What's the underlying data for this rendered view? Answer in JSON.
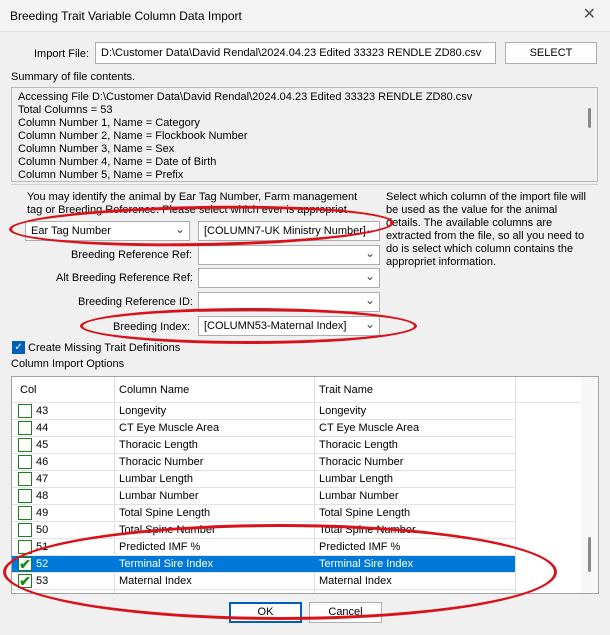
{
  "window": {
    "title": "Breeding Trait Variable Column Data Import",
    "close_glyph": "✕"
  },
  "import_file": {
    "label": "Import File:",
    "value": "D:\\Customer Data\\David Rendal\\2024.04.23 Edited 33323 RENDLE ZD80.csv",
    "select_label": "SELECT"
  },
  "summary": {
    "label": "Summary of file contents.",
    "lines": [
      "Accessing File D:\\Customer Data\\David Rendal\\2024.04.23 Edited 33323 RENDLE ZD80.csv",
      "Total Columns  = 53",
      "Column Number 1, Name = Category",
      "Column Number 2, Name = Flockbook Number",
      "Column Number 3, Name = Sex",
      "Column Number 4, Name = Date of Birth",
      "Column Number 5, Name = Prefix"
    ]
  },
  "identify_text": "You may identify the animal by Ear Tag Number, Farm management tag or Breeding Reference. Please select which ever is appropriet",
  "select_help": "Select which column of the import file will be used as the value for the animal details. The available columns are extracted from the file, so all you need to do is select which column contains the appropriet information.",
  "id_type": {
    "value": "Ear Tag Number"
  },
  "id_column": {
    "value": "[COLUMN7-UK Ministry Number]"
  },
  "breeding_ref": {
    "label": "Breeding Reference Ref:",
    "value": ""
  },
  "alt_breeding_ref": {
    "label": "Alt Breeding Reference Ref:",
    "value": ""
  },
  "breeding_ref_id": {
    "label": "Breeding Reference ID:",
    "value": ""
  },
  "breeding_index": {
    "label": "Breeding Index:",
    "value": "[COLUMN53-Maternal Index]"
  },
  "create_missing": {
    "label": "Create Missing Trait Definitions",
    "checked": true
  },
  "column_import_options": "Column Import Options",
  "grid": {
    "headers": {
      "col": "Col",
      "column_name": "Column Name",
      "trait_name": "Trait Name"
    },
    "rows": [
      {
        "col": "43",
        "column_name": "Longevity",
        "trait_name": "Longevity",
        "checked": false,
        "selected": false
      },
      {
        "col": "44",
        "column_name": "CT Eye Muscle Area",
        "trait_name": "CT Eye Muscle Area",
        "checked": false,
        "selected": false
      },
      {
        "col": "45",
        "column_name": "Thoracic Length",
        "trait_name": "Thoracic Length",
        "checked": false,
        "selected": false
      },
      {
        "col": "46",
        "column_name": "Thoracic Number",
        "trait_name": "Thoracic Number",
        "checked": false,
        "selected": false
      },
      {
        "col": "47",
        "column_name": "Lumbar Length",
        "trait_name": "Lumbar Length",
        "checked": false,
        "selected": false
      },
      {
        "col": "48",
        "column_name": "Lumbar Number",
        "trait_name": "Lumbar Number",
        "checked": false,
        "selected": false
      },
      {
        "col": "49",
        "column_name": "Total Spine Length",
        "trait_name": "Total Spine Length",
        "checked": false,
        "selected": false
      },
      {
        "col": "50",
        "column_name": "Total Spine Number",
        "trait_name": "Total Spine Number",
        "checked": false,
        "selected": false
      },
      {
        "col": "51",
        "column_name": "Predicted IMF %",
        "trait_name": "Predicted IMF %",
        "checked": false,
        "selected": false
      },
      {
        "col": "52",
        "column_name": "Terminal Sire Index",
        "trait_name": "Terminal Sire Index",
        "checked": true,
        "selected": true
      },
      {
        "col": "53",
        "column_name": "Maternal Index",
        "trait_name": "Maternal Index",
        "checked": true,
        "selected": false
      }
    ]
  },
  "buttons": {
    "ok": "OK",
    "cancel": "Cancel"
  },
  "colors": {
    "annotation": "#d9121a",
    "selection": "#0078d7",
    "accent": "#005fb8"
  }
}
